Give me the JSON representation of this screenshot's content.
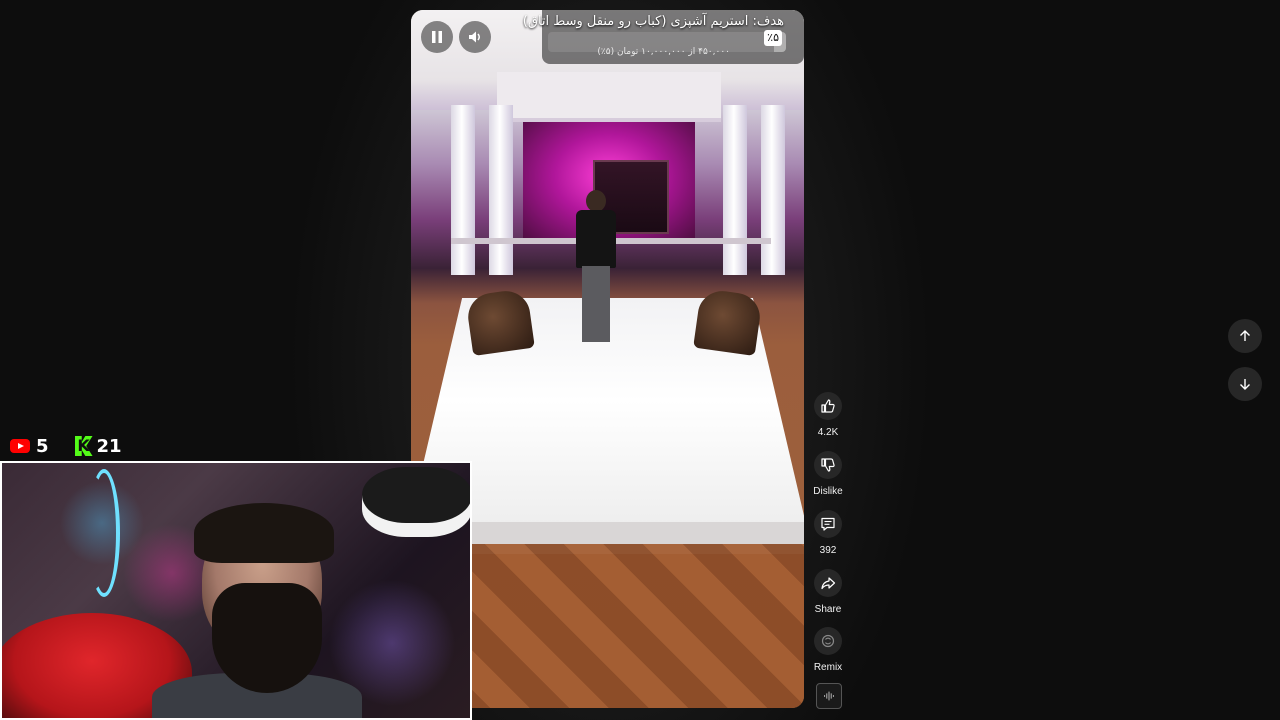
{
  "video": {
    "goal": {
      "title": "هدف: استریم آشپزی (کباب رو منقل وسط اتاق)",
      "percent": "٪۵",
      "amount": "۴۵۰,۰۰۰ از ۱۰,۰۰۰,۰۰۰ تومان (۵٪)",
      "progress_fraction": 0.05
    },
    "controls": {
      "pause_icon": "pause-icon",
      "volume_icon": "volume-icon"
    }
  },
  "actions": {
    "like": {
      "label": "4.2K",
      "icon": "thumbs-up-icon"
    },
    "dislike": {
      "label": "Dislike",
      "icon": "thumbs-down-icon"
    },
    "comments": {
      "label": "392",
      "icon": "comment-icon"
    },
    "share": {
      "label": "Share",
      "icon": "share-icon"
    },
    "remix": {
      "label": "Remix",
      "icon": "remix-icon"
    }
  },
  "navigation": {
    "up_icon": "arrow-up-icon",
    "down_icon": "arrow-down-icon"
  },
  "stream_overlay": {
    "youtube_viewers": "5",
    "kick_viewers": "21",
    "kick_letter": "K"
  },
  "colors": {
    "youtube_red": "#ff0000",
    "kick_green": "#53fc18",
    "button_bg": "#272727",
    "page_bg": "#0f0f0f"
  }
}
